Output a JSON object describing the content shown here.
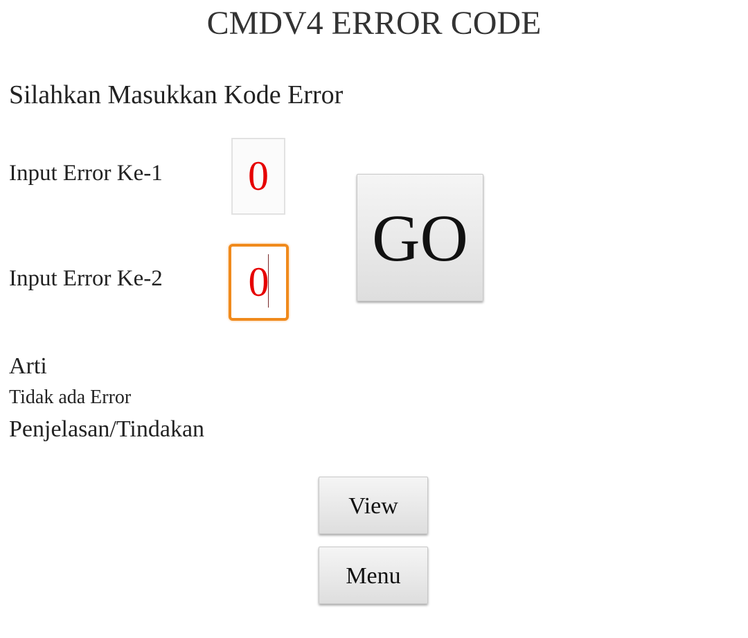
{
  "page": {
    "title": "CMDV4 ERROR CODE",
    "subtitle": "Silahkan Masukkan Kode Error"
  },
  "inputs": {
    "error1": {
      "label": "Input Error Ke-1",
      "value": "0"
    },
    "error2": {
      "label": "Input Error Ke-2",
      "value": "0"
    }
  },
  "buttons": {
    "go": "GO",
    "view": "View",
    "menu": "Menu"
  },
  "result": {
    "arti_label": "Arti",
    "arti_value": "Tidak ada Error",
    "penjelasan_label": "Penjelasan/Tindakan"
  },
  "colors": {
    "input_text": "#e60000",
    "focus_border": "#f08a1c"
  }
}
